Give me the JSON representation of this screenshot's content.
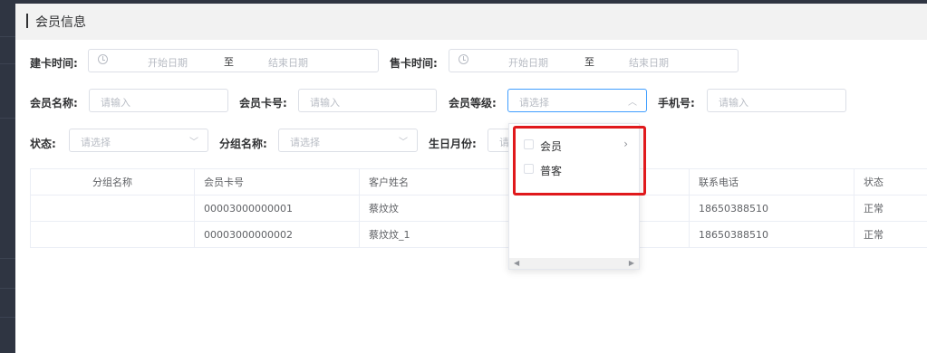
{
  "header": {
    "title": "会员信息"
  },
  "filters": {
    "create_time": {
      "label": "建卡时间:",
      "start": "开始日期",
      "sep": "至",
      "end": "结束日期"
    },
    "sell_time": {
      "label": "售卡时间:",
      "start": "开始日期",
      "sep": "至",
      "end": "结束日期"
    },
    "member_name": {
      "label": "会员名称:",
      "placeholder": "请输入"
    },
    "card_no": {
      "label": "会员卡号:",
      "placeholder": "请输入"
    },
    "level": {
      "label": "会员等级:",
      "placeholder": "请选择"
    },
    "phone": {
      "label": "手机号:",
      "placeholder": "请输入"
    },
    "status": {
      "label": "状态:",
      "placeholder": "请选择"
    },
    "group": {
      "label": "分组名称:",
      "placeholder": "请选择"
    },
    "birth_month": {
      "label": "生日月份:",
      "placeholder": "请"
    }
  },
  "dropdown": {
    "options": [
      {
        "label": "会员",
        "has_children": true
      },
      {
        "label": "普客",
        "has_children": false
      }
    ]
  },
  "table": {
    "columns": [
      "分组名称",
      "会员卡号",
      "客户姓名",
      "",
      "联系电话",
      "状态"
    ],
    "rows": [
      [
        "",
        "00003000000001",
        "蔡炆炆",
        "",
        "18650388510",
        "正常"
      ],
      [
        "",
        "00003000000002",
        "蔡炆炆_1",
        "",
        "18650388510",
        "正常"
      ]
    ]
  },
  "icons": {
    "clock": "clock-icon",
    "arrow_down": "chevron-down-icon",
    "arrow_up": "chevron-up-icon",
    "arrow_right": "chevron-right-icon"
  },
  "colors": {
    "focus": "#409eff",
    "highlight": "#e0191c"
  }
}
